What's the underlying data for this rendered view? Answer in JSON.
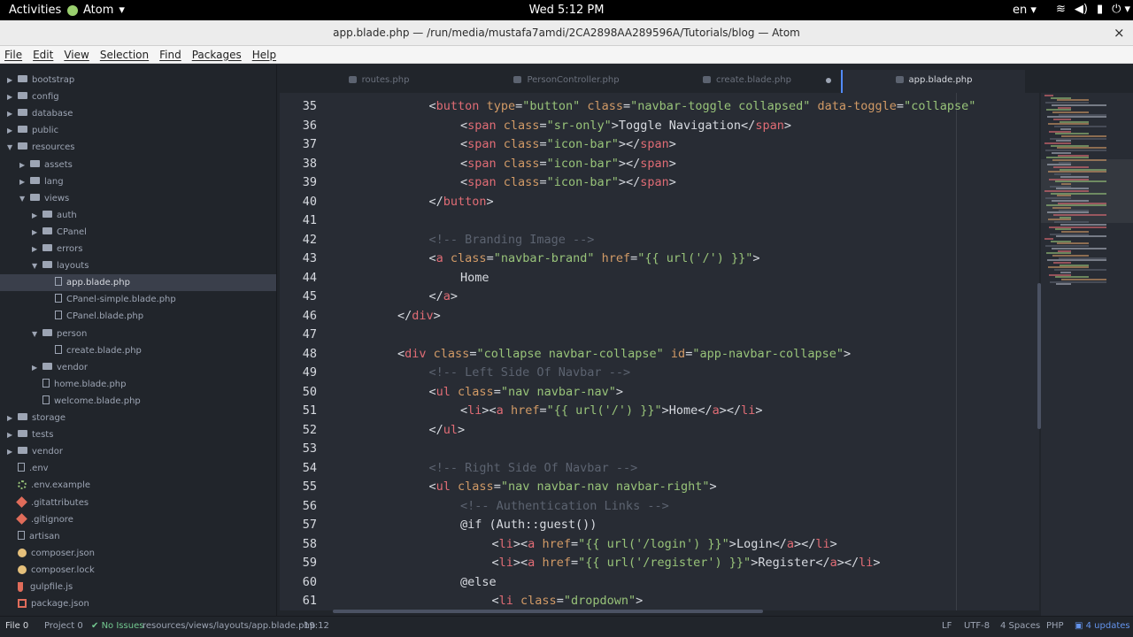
{
  "topbar": {
    "activities": "Activities",
    "app_name": "Atom",
    "clock": "Wed  5:12 PM",
    "language": "en",
    "icons": [
      "wifi-icon",
      "volume-icon",
      "battery-icon",
      "power-icon"
    ]
  },
  "window": {
    "title": "app.blade.php — /run/media/mustafa7amdi/2CA2898AA289596A/Tutorials/blog — Atom",
    "close": "×"
  },
  "menu": [
    "File",
    "Edit",
    "View",
    "Selection",
    "Find",
    "Packages",
    "Help"
  ],
  "tree": [
    {
      "label": "bootstrap",
      "kind": "folder",
      "depth": 1,
      "open": false
    },
    {
      "label": "config",
      "kind": "folder",
      "depth": 1,
      "open": false
    },
    {
      "label": "database",
      "kind": "folder",
      "depth": 1,
      "open": false
    },
    {
      "label": "public",
      "kind": "folder",
      "depth": 1,
      "open": false
    },
    {
      "label": "resources",
      "kind": "folder",
      "depth": 1,
      "open": true
    },
    {
      "label": "assets",
      "kind": "folder",
      "depth": 2,
      "open": false
    },
    {
      "label": "lang",
      "kind": "folder",
      "depth": 2,
      "open": false
    },
    {
      "label": "views",
      "kind": "folder",
      "depth": 2,
      "open": true
    },
    {
      "label": "auth",
      "kind": "folder",
      "depth": 3,
      "open": false
    },
    {
      "label": "CPanel",
      "kind": "folder",
      "depth": 3,
      "open": false
    },
    {
      "label": "errors",
      "kind": "folder",
      "depth": 3,
      "open": false
    },
    {
      "label": "layouts",
      "kind": "folder",
      "depth": 3,
      "open": true
    },
    {
      "label": "app.blade.php",
      "kind": "file",
      "depth": 4,
      "selected": true
    },
    {
      "label": "CPanel-simple.blade.php",
      "kind": "file",
      "depth": 4
    },
    {
      "label": "CPanel.blade.php",
      "kind": "file",
      "depth": 4
    },
    {
      "label": "person",
      "kind": "folder",
      "depth": 3,
      "open": true
    },
    {
      "label": "create.blade.php",
      "kind": "file",
      "depth": 4
    },
    {
      "label": "vendor",
      "kind": "folder",
      "depth": 3,
      "open": false
    },
    {
      "label": "home.blade.php",
      "kind": "file",
      "depth": 3
    },
    {
      "label": "welcome.blade.php",
      "kind": "file",
      "depth": 3
    },
    {
      "label": "storage",
      "kind": "folder",
      "depth": 1,
      "open": false
    },
    {
      "label": "tests",
      "kind": "folder",
      "depth": 1,
      "open": false
    },
    {
      "label": "vendor",
      "kind": "folder",
      "depth": 1,
      "open": false
    },
    {
      "label": ".env",
      "kind": "file",
      "depth": 1
    },
    {
      "label": ".env.example",
      "kind": "gear",
      "depth": 1
    },
    {
      "label": ".gitattributes",
      "kind": "git",
      "depth": 1
    },
    {
      "label": ".gitignore",
      "kind": "git",
      "depth": 1
    },
    {
      "label": "artisan",
      "kind": "file",
      "depth": 1
    },
    {
      "label": "composer.json",
      "kind": "json",
      "depth": 1
    },
    {
      "label": "composer.lock",
      "kind": "lock",
      "depth": 1
    },
    {
      "label": "gulpfile.js",
      "kind": "gulp",
      "depth": 1
    },
    {
      "label": "package.json",
      "kind": "pkg",
      "depth": 1
    }
  ],
  "tabs": [
    {
      "label": "routes.php",
      "active": false,
      "modified": false
    },
    {
      "label": "PersonController.php",
      "active": false,
      "modified": false
    },
    {
      "label": "create.blade.php",
      "active": false,
      "modified": true
    },
    {
      "label": "app.blade.php",
      "active": true,
      "modified": false
    }
  ],
  "code": [
    {
      "n": "35",
      "indent": 4,
      "tokens": [
        [
          "p",
          "<"
        ],
        [
          "tag",
          "button"
        ],
        [
          "p",
          " "
        ],
        [
          "attr",
          "type"
        ],
        [
          "p",
          "="
        ],
        [
          "str",
          "\"button\""
        ],
        [
          "p",
          " "
        ],
        [
          "attr",
          "class"
        ],
        [
          "p",
          "="
        ],
        [
          "str",
          "\"navbar-toggle collapsed\""
        ],
        [
          "p",
          " "
        ],
        [
          "attr",
          "data-toggle"
        ],
        [
          "p",
          "="
        ],
        [
          "str",
          "\"collapse\""
        ]
      ]
    },
    {
      "n": "36",
      "indent": 5,
      "tokens": [
        [
          "p",
          "<"
        ],
        [
          "tag",
          "span"
        ],
        [
          "p",
          " "
        ],
        [
          "attr",
          "class"
        ],
        [
          "p",
          "="
        ],
        [
          "str",
          "\"sr-only\""
        ],
        [
          "p",
          ">"
        ],
        [
          "tx",
          "Toggle Navigation"
        ],
        [
          "p",
          "</"
        ],
        [
          "tag",
          "span"
        ],
        [
          "p",
          ">"
        ]
      ]
    },
    {
      "n": "37",
      "indent": 5,
      "tokens": [
        [
          "p",
          "<"
        ],
        [
          "tag",
          "span"
        ],
        [
          "p",
          " "
        ],
        [
          "attr",
          "class"
        ],
        [
          "p",
          "="
        ],
        [
          "str",
          "\"icon-bar\""
        ],
        [
          "p",
          "></"
        ],
        [
          "tag",
          "span"
        ],
        [
          "p",
          ">"
        ]
      ]
    },
    {
      "n": "38",
      "indent": 5,
      "tokens": [
        [
          "p",
          "<"
        ],
        [
          "tag",
          "span"
        ],
        [
          "p",
          " "
        ],
        [
          "attr",
          "class"
        ],
        [
          "p",
          "="
        ],
        [
          "str",
          "\"icon-bar\""
        ],
        [
          "p",
          "></"
        ],
        [
          "tag",
          "span"
        ],
        [
          "p",
          ">"
        ]
      ]
    },
    {
      "n": "39",
      "indent": 5,
      "tokens": [
        [
          "p",
          "<"
        ],
        [
          "tag",
          "span"
        ],
        [
          "p",
          " "
        ],
        [
          "attr",
          "class"
        ],
        [
          "p",
          "="
        ],
        [
          "str",
          "\"icon-bar\""
        ],
        [
          "p",
          "></"
        ],
        [
          "tag",
          "span"
        ],
        [
          "p",
          ">"
        ]
      ]
    },
    {
      "n": "40",
      "indent": 4,
      "tokens": [
        [
          "p",
          "</"
        ],
        [
          "tag",
          "button"
        ],
        [
          "p",
          ">"
        ]
      ]
    },
    {
      "n": "41",
      "indent": 0,
      "tokens": []
    },
    {
      "n": "42",
      "indent": 4,
      "tokens": [
        [
          "cm",
          "<!-- Branding Image -->"
        ]
      ]
    },
    {
      "n": "43",
      "indent": 4,
      "tokens": [
        [
          "p",
          "<"
        ],
        [
          "tag",
          "a"
        ],
        [
          "p",
          " "
        ],
        [
          "attr",
          "class"
        ],
        [
          "p",
          "="
        ],
        [
          "str",
          "\"navbar-brand\""
        ],
        [
          "p",
          " "
        ],
        [
          "attr",
          "href"
        ],
        [
          "p",
          "="
        ],
        [
          "str",
          "\"{{ url('/') }}\""
        ],
        [
          "p",
          ">"
        ]
      ]
    },
    {
      "n": "44",
      "indent": 5,
      "tokens": [
        [
          "tx",
          "Home"
        ]
      ]
    },
    {
      "n": "45",
      "indent": 4,
      "tokens": [
        [
          "p",
          "</"
        ],
        [
          "tag",
          "a"
        ],
        [
          "p",
          ">"
        ]
      ]
    },
    {
      "n": "46",
      "indent": 3,
      "tokens": [
        [
          "p",
          "</"
        ],
        [
          "tag",
          "div"
        ],
        [
          "p",
          ">"
        ]
      ]
    },
    {
      "n": "47",
      "indent": 0,
      "tokens": []
    },
    {
      "n": "48",
      "indent": 3,
      "tokens": [
        [
          "p",
          "<"
        ],
        [
          "tag",
          "div"
        ],
        [
          "p",
          " "
        ],
        [
          "attr",
          "class"
        ],
        [
          "p",
          "="
        ],
        [
          "str",
          "\"collapse navbar-collapse\""
        ],
        [
          "p",
          " "
        ],
        [
          "attr",
          "id"
        ],
        [
          "p",
          "="
        ],
        [
          "str",
          "\"app-navbar-collapse\""
        ],
        [
          "p",
          ">"
        ]
      ]
    },
    {
      "n": "49",
      "indent": 4,
      "tokens": [
        [
          "cm",
          "<!-- Left Side Of Navbar -->"
        ]
      ]
    },
    {
      "n": "50",
      "indent": 4,
      "tokens": [
        [
          "p",
          "<"
        ],
        [
          "tag",
          "ul"
        ],
        [
          "p",
          " "
        ],
        [
          "attr",
          "class"
        ],
        [
          "p",
          "="
        ],
        [
          "str",
          "\"nav navbar-nav\""
        ],
        [
          "p",
          ">"
        ]
      ]
    },
    {
      "n": "51",
      "indent": 5,
      "tokens": [
        [
          "p",
          "<"
        ],
        [
          "tag",
          "li"
        ],
        [
          "p",
          "><"
        ],
        [
          "tag",
          "a"
        ],
        [
          "p",
          " "
        ],
        [
          "attr",
          "href"
        ],
        [
          "p",
          "="
        ],
        [
          "str",
          "\"{{ url('/') }}\""
        ],
        [
          "p",
          ">"
        ],
        [
          "tx",
          "Home"
        ],
        [
          "p",
          "</"
        ],
        [
          "tag",
          "a"
        ],
        [
          "p",
          "></"
        ],
        [
          "tag",
          "li"
        ],
        [
          "p",
          ">"
        ]
      ]
    },
    {
      "n": "52",
      "indent": 4,
      "tokens": [
        [
          "p",
          "</"
        ],
        [
          "tag",
          "ul"
        ],
        [
          "p",
          ">"
        ]
      ]
    },
    {
      "n": "53",
      "indent": 0,
      "tokens": []
    },
    {
      "n": "54",
      "indent": 4,
      "tokens": [
        [
          "cm",
          "<!-- Right Side Of Navbar -->"
        ]
      ]
    },
    {
      "n": "55",
      "indent": 4,
      "tokens": [
        [
          "p",
          "<"
        ],
        [
          "tag",
          "ul"
        ],
        [
          "p",
          " "
        ],
        [
          "attr",
          "class"
        ],
        [
          "p",
          "="
        ],
        [
          "str",
          "\"nav navbar-nav navbar-right\""
        ],
        [
          "p",
          ">"
        ]
      ]
    },
    {
      "n": "56",
      "indent": 5,
      "tokens": [
        [
          "cm",
          "<!-- Authentication Links -->"
        ]
      ]
    },
    {
      "n": "57",
      "indent": 5,
      "tokens": [
        [
          "tx",
          "@if (Auth::guest())"
        ]
      ]
    },
    {
      "n": "58",
      "indent": 6,
      "tokens": [
        [
          "p",
          "<"
        ],
        [
          "tag",
          "li"
        ],
        [
          "p",
          "><"
        ],
        [
          "tag",
          "a"
        ],
        [
          "p",
          " "
        ],
        [
          "attr",
          "href"
        ],
        [
          "p",
          "="
        ],
        [
          "str",
          "\"{{ url('/login') }}\""
        ],
        [
          "p",
          ">"
        ],
        [
          "tx",
          "Login"
        ],
        [
          "p",
          "</"
        ],
        [
          "tag",
          "a"
        ],
        [
          "p",
          "></"
        ],
        [
          "tag",
          "li"
        ],
        [
          "p",
          ">"
        ]
      ]
    },
    {
      "n": "59",
      "indent": 6,
      "tokens": [
        [
          "p",
          "<"
        ],
        [
          "tag",
          "li"
        ],
        [
          "p",
          "><"
        ],
        [
          "tag",
          "a"
        ],
        [
          "p",
          " "
        ],
        [
          "attr",
          "href"
        ],
        [
          "p",
          "="
        ],
        [
          "str",
          "\"{{ url('/register') }}\""
        ],
        [
          "p",
          ">"
        ],
        [
          "tx",
          "Register"
        ],
        [
          "p",
          "</"
        ],
        [
          "tag",
          "a"
        ],
        [
          "p",
          "></"
        ],
        [
          "tag",
          "li"
        ],
        [
          "p",
          ">"
        ]
      ]
    },
    {
      "n": "60",
      "indent": 5,
      "tokens": [
        [
          "tx",
          "@else"
        ]
      ]
    },
    {
      "n": "61",
      "indent": 6,
      "tokens": [
        [
          "p",
          "<"
        ],
        [
          "tag",
          "li"
        ],
        [
          "p",
          " "
        ],
        [
          "attr",
          "class"
        ],
        [
          "p",
          "="
        ],
        [
          "str",
          "\"dropdown\""
        ],
        [
          "p",
          ">"
        ]
      ]
    }
  ],
  "status": {
    "file_tab": "File",
    "file_count": "0",
    "project": "Project 0",
    "issues": "No Issues",
    "path": "resources/views/layouts/app.blade.php",
    "cursor": "19:12",
    "line_ending": "LF",
    "encoding": "UTF-8",
    "indent": "4 Spaces",
    "grammar": "PHP",
    "updates": "4 updates"
  },
  "colors": {
    "tag": "#e06c75",
    "attr": "#d19a66",
    "string": "#98c379",
    "comment": "#5c6370",
    "background": "#282c34"
  }
}
